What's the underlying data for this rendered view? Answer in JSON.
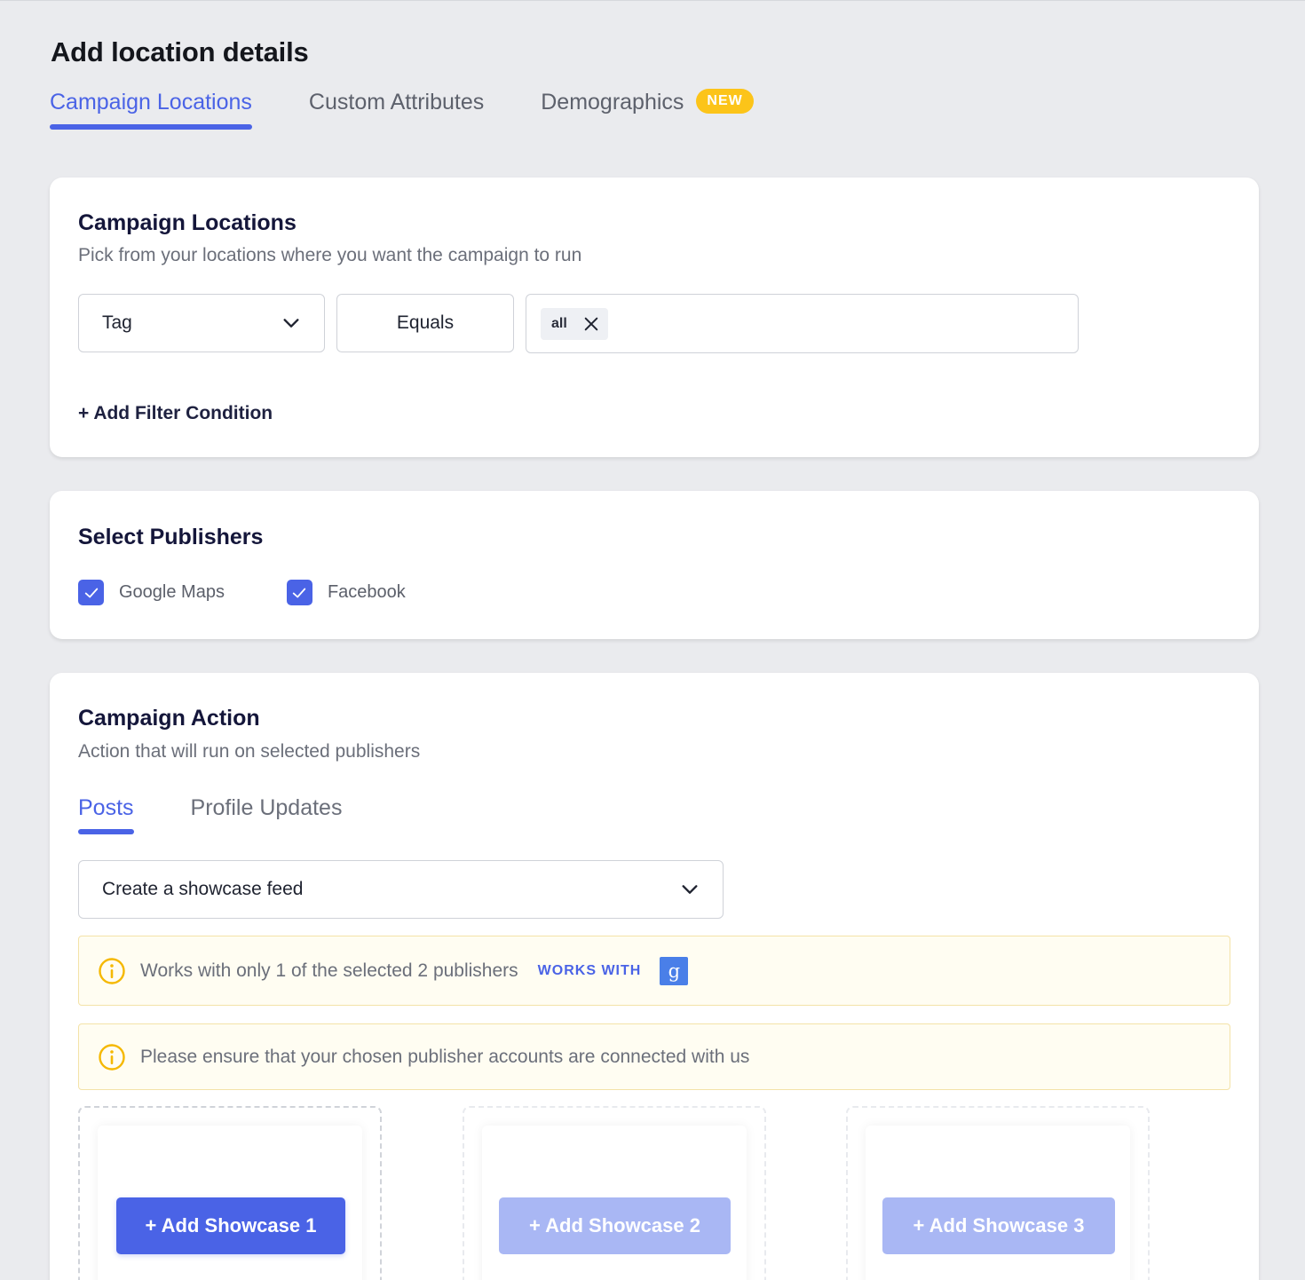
{
  "page_title": "Add location details",
  "main_tabs": [
    {
      "label": "Campaign Locations",
      "active": true
    },
    {
      "label": "Custom Attributes",
      "active": false
    },
    {
      "label": "Demographics",
      "active": false,
      "badge": "NEW"
    }
  ],
  "locations_card": {
    "title": "Campaign Locations",
    "subtitle": "Pick from your locations where you want the campaign to run",
    "filter": {
      "field_value": "Tag",
      "operator_value": "Equals",
      "chips": [
        "all"
      ]
    },
    "add_filter_label": "+ Add Filter Condition"
  },
  "publishers_card": {
    "title": "Select Publishers",
    "publishers": [
      {
        "label": "Google Maps",
        "checked": true
      },
      {
        "label": "Facebook",
        "checked": true
      }
    ]
  },
  "action_card": {
    "title": "Campaign Action",
    "subtitle": "Action that will run on selected publishers",
    "tabs": [
      {
        "label": "Posts",
        "active": true
      },
      {
        "label": "Profile Updates",
        "active": false
      }
    ],
    "action_select_value": "Create a showcase feed",
    "alerts": [
      {
        "text": "Works with only 1 of the selected 2 publishers",
        "tag": "WORKS WITH",
        "publisher_icon": "g"
      },
      {
        "text": "Please ensure that your chosen publisher accounts are connected with us"
      }
    ],
    "showcase_buttons": [
      {
        "label": "+ Add Showcase 1",
        "enabled": true
      },
      {
        "label": "+ Add Showcase 2",
        "enabled": false
      },
      {
        "label": "+ Add Showcase 3",
        "enabled": false
      }
    ]
  },
  "colors": {
    "accent": "#4a63e6",
    "badge": "#fcc419",
    "alert_bg": "#fffdf2",
    "alert_icon": "#f5b800",
    "page_bg": "#eaebee"
  }
}
